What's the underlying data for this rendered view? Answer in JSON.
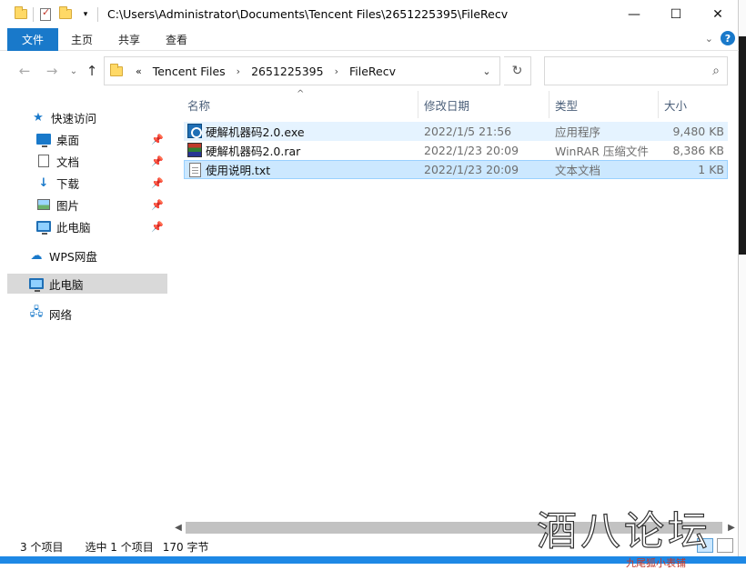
{
  "window": {
    "path": "C:\\Users\\Administrator\\Documents\\Tencent Files\\2651225395\\FileRecv",
    "controls": {
      "minimize": "—",
      "maximize": "☐",
      "close": "✕"
    }
  },
  "ribbon": {
    "tabs": [
      "文件",
      "主页",
      "共享",
      "查看"
    ],
    "help": "?"
  },
  "address": {
    "overflow": "«",
    "crumbs": [
      "Tencent Files",
      "2651225395",
      "FileRecv"
    ],
    "search_placeholder": ""
  },
  "nav": {
    "items": [
      {
        "label": "快速访问",
        "icon": "star-icon"
      },
      {
        "label": "桌面",
        "icon": "desktop-icon",
        "pinned": true
      },
      {
        "label": "文档",
        "icon": "document-icon",
        "pinned": true
      },
      {
        "label": "下载",
        "icon": "download-icon",
        "pinned": true
      },
      {
        "label": "图片",
        "icon": "picture-icon",
        "pinned": true
      },
      {
        "label": "此电脑",
        "icon": "computer-icon",
        "pinned": true
      },
      {
        "label": "WPS网盘",
        "icon": "cloud-icon"
      },
      {
        "label": "此电脑",
        "icon": "computer-icon",
        "selected": true
      },
      {
        "label": "网络",
        "icon": "network-icon"
      }
    ]
  },
  "columns": {
    "name": "名称",
    "date": "修改日期",
    "type": "类型",
    "size": "大小"
  },
  "files": [
    {
      "name": "硬解机器码2.0.exe",
      "date": "2022/1/5 21:56",
      "type": "应用程序",
      "size": "9,480 KB",
      "icon": "exe-icon"
    },
    {
      "name": "硬解机器码2.0.rar",
      "date": "2022/1/23 20:09",
      "type": "WinRAR 压缩文件",
      "size": "8,386 KB",
      "icon": "rar-icon"
    },
    {
      "name": "使用说明.txt",
      "date": "2022/1/23 20:09",
      "type": "文本文档",
      "size": "1 KB",
      "icon": "txt-icon"
    }
  ],
  "status": {
    "count": "3 个项目",
    "selected": "选中 1 个项目",
    "size": "170 字节"
  },
  "watermark": "酒八论坛",
  "background_snippet": "九尾狐小表铺"
}
